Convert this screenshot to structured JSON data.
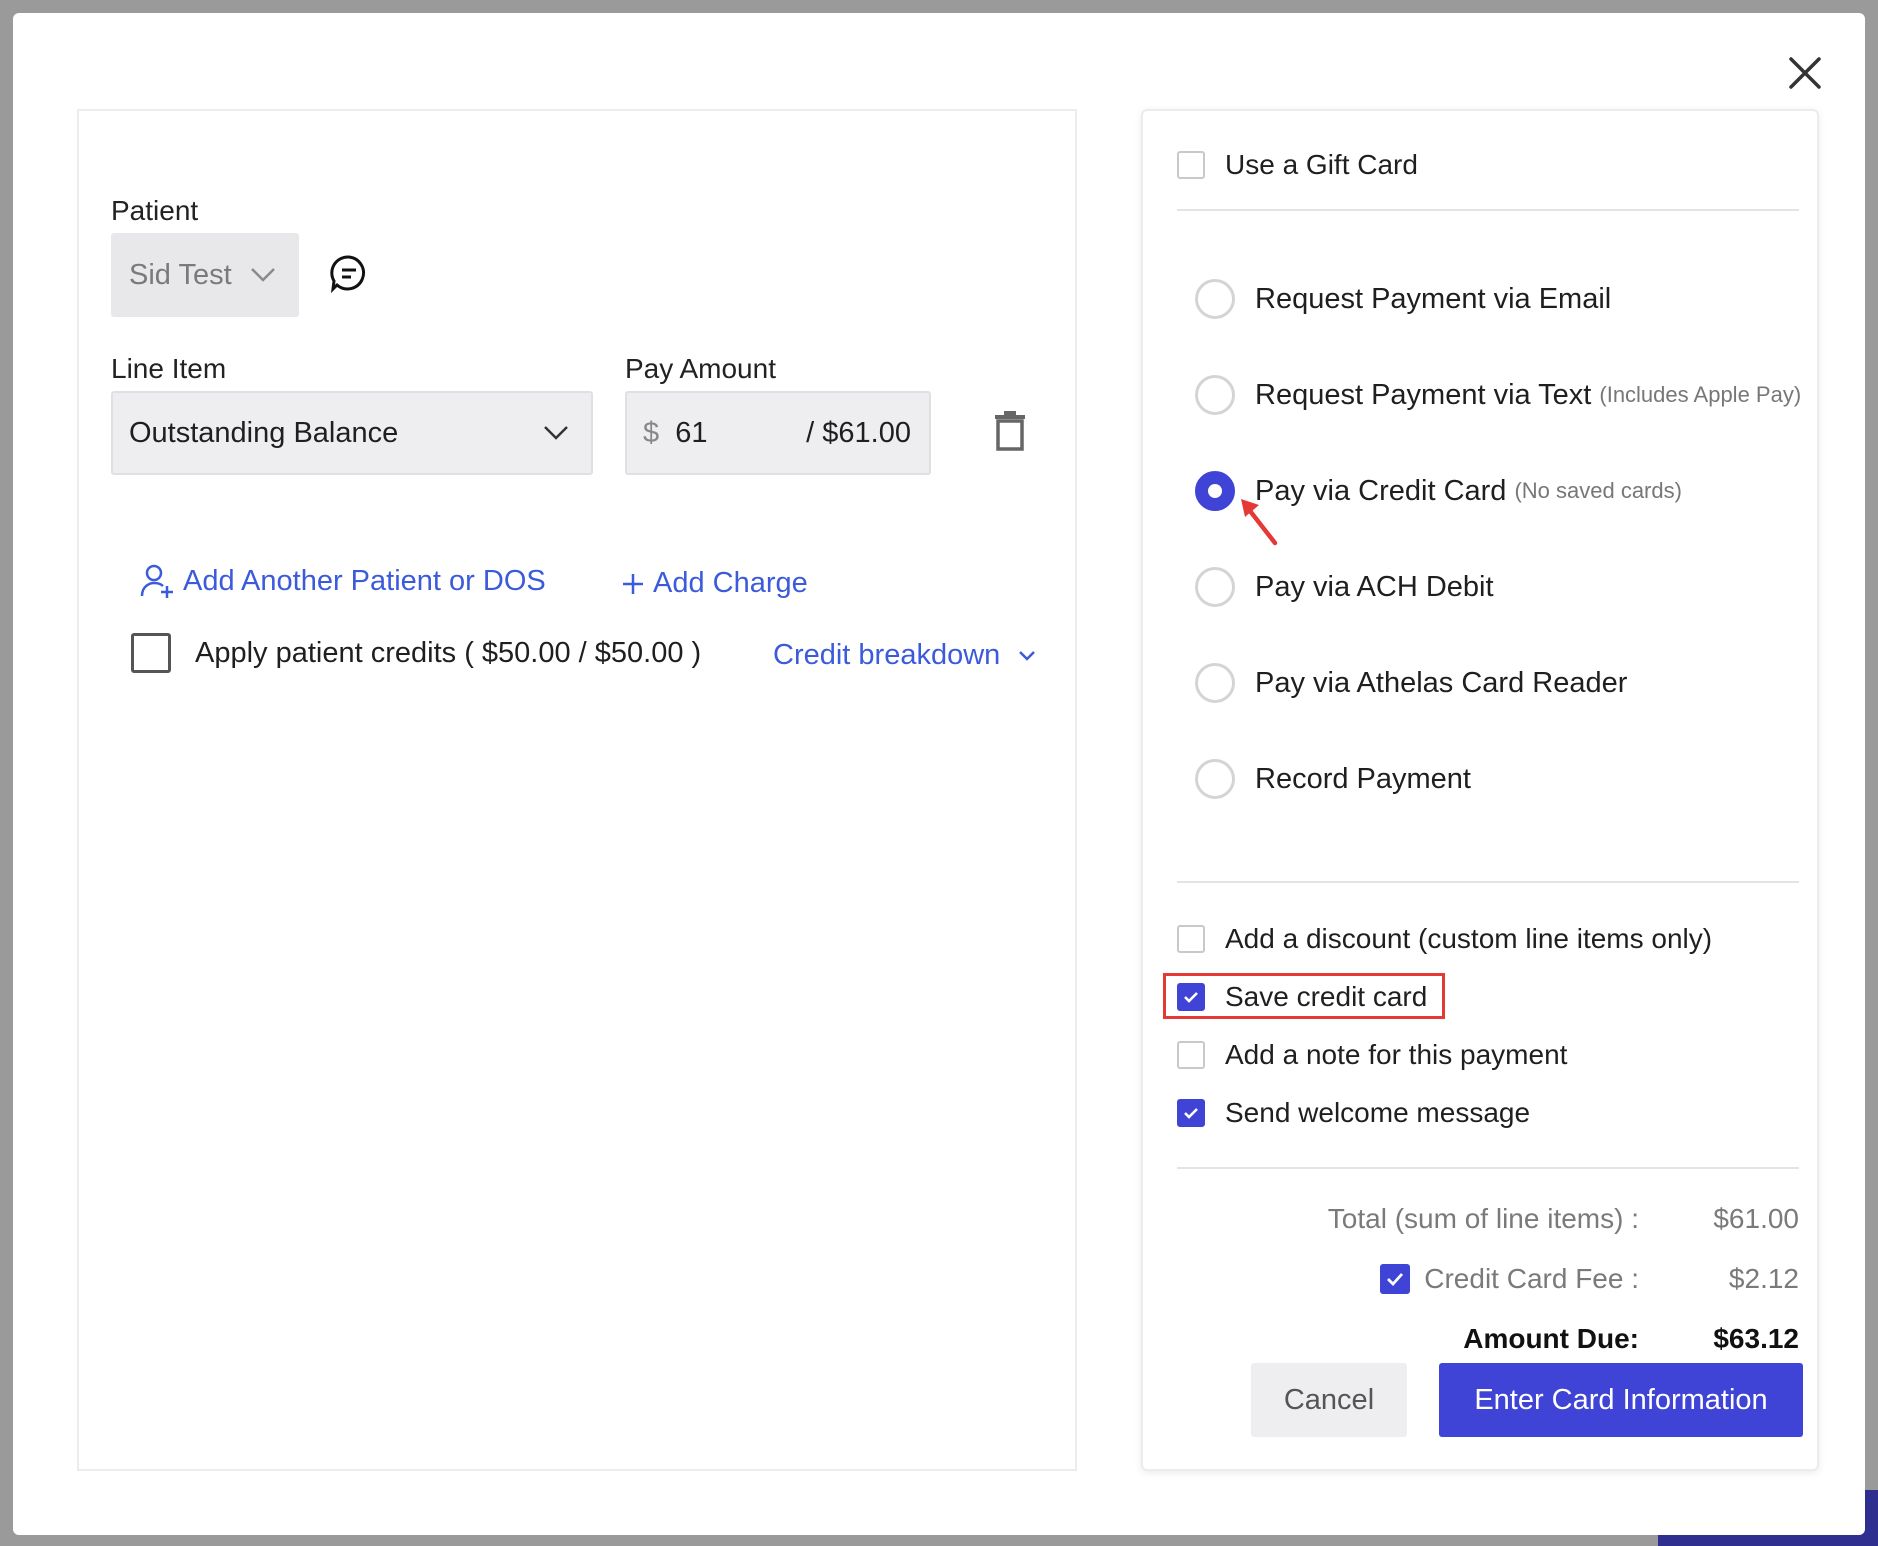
{
  "left": {
    "patient_label": "Patient",
    "patient_value": "Sid Test",
    "line_item_label": "Line Item",
    "line_item_value": "Outstanding Balance",
    "pay_amount_label": "Pay Amount",
    "pay_currency": "$",
    "pay_amount_value": "61",
    "pay_amount_total": "/ $61.00",
    "add_patient_link": "Add Another Patient or DOS",
    "add_charge_link": "Add Charge",
    "apply_credits_label": "Apply patient credits ( $50.00 / $50.00 )",
    "credit_breakdown_link": "Credit breakdown"
  },
  "right": {
    "gift_card_label": "Use a Gift Card",
    "payment_options": [
      {
        "label": "Request Payment via Email",
        "hint": "",
        "selected": false
      },
      {
        "label": "Request Payment via Text",
        "hint": "(Includes Apple Pay)",
        "selected": false
      },
      {
        "label": "Pay via Credit Card",
        "hint": "(No saved cards)",
        "selected": true
      },
      {
        "label": "Pay via ACH Debit",
        "hint": "",
        "selected": false
      },
      {
        "label": "Pay via Athelas Card Reader",
        "hint": "",
        "selected": false
      },
      {
        "label": "Record Payment",
        "hint": "",
        "selected": false
      }
    ],
    "options": [
      {
        "label": "Add a discount (custom line items only)",
        "checked": false
      },
      {
        "label": "Save credit card",
        "checked": true
      },
      {
        "label": "Add a note for this payment",
        "checked": false
      },
      {
        "label": "Send welcome message",
        "checked": true
      }
    ],
    "summary": {
      "total_label": "Total (sum of line items) :",
      "total_value": "$61.00",
      "fee_label": "Credit Card Fee :",
      "fee_value": "$2.12",
      "fee_checked": true,
      "due_label": "Amount Due:",
      "due_value": "$63.12"
    },
    "cancel_label": "Cancel",
    "submit_label": "Enter Card Information"
  },
  "colors": {
    "accent": "#3f43d6",
    "link": "#3b5bdb",
    "highlight": "#e53935"
  }
}
